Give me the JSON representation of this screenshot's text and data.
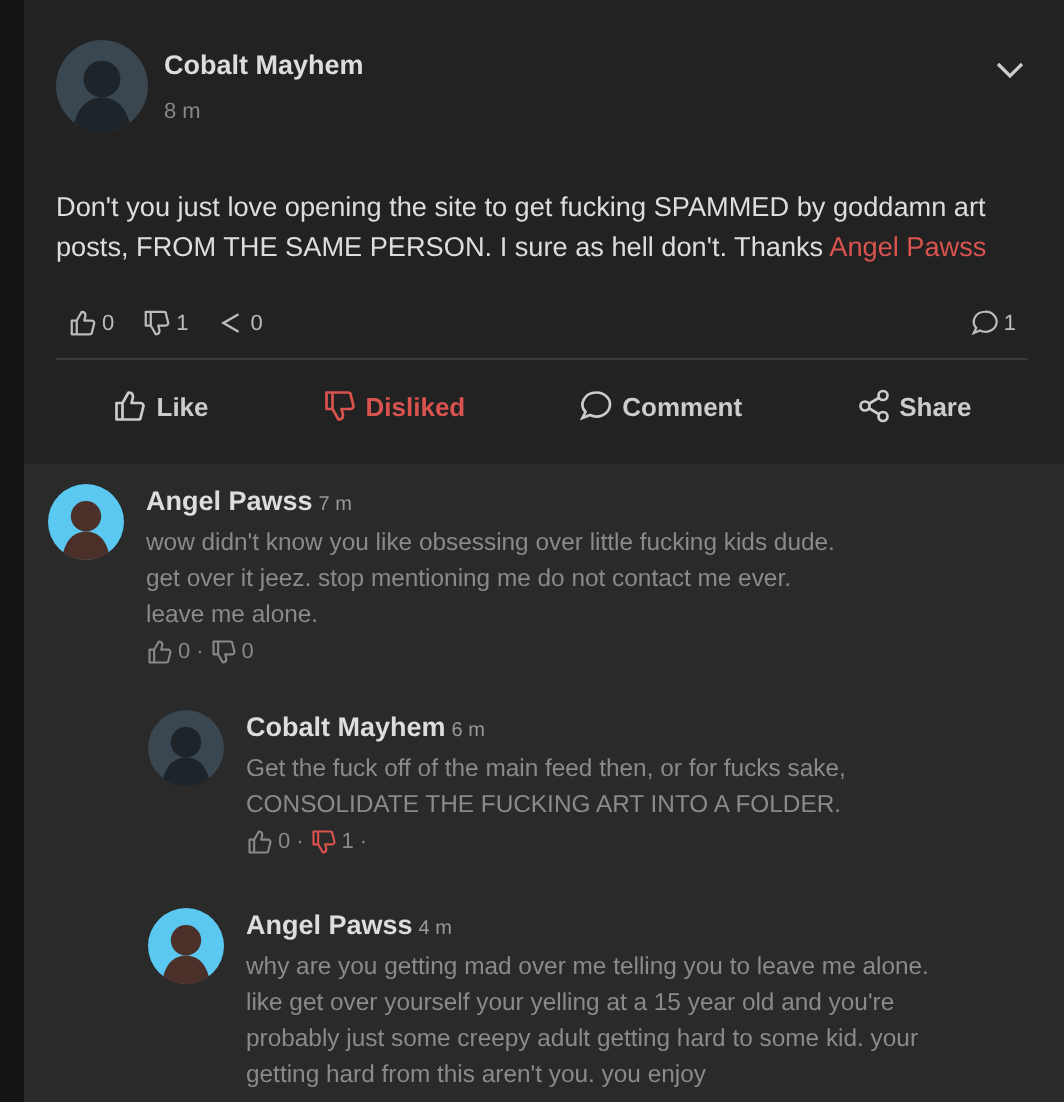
{
  "post": {
    "author": "Cobalt Mayhem",
    "time": "8 m",
    "text": "Don't you just love opening the site to get fucking SPAMMED by goddamn art posts, FROM THE SAME PERSON. I sure as hell don't. Thanks ",
    "mention": "Angel Pawss",
    "stats": [
      {
        "kind": "like",
        "count": "0"
      },
      {
        "kind": "dislike",
        "count": "1"
      },
      {
        "kind": "share",
        "count": "0"
      },
      {
        "kind": "comment",
        "count": "1"
      }
    ],
    "actions": [
      {
        "kind": "like",
        "label": "Like",
        "active": false
      },
      {
        "kind": "dislike",
        "label": "Disliked",
        "active": true
      },
      {
        "kind": "comment",
        "label": "Comment",
        "active": false
      },
      {
        "kind": "share",
        "label": "Share",
        "active": false
      }
    ]
  },
  "comments": [
    {
      "author": "Angel Pawss",
      "time": "7 m",
      "kind": "blue",
      "text": "wow didn't know you like obsessing over little fucking kids dude. get over it jeez. stop mentioning me do not contact me ever. leave me alone.",
      "votes": [
        {
          "kind": "like",
          "count": "0",
          "active": false,
          "sep": "·"
        },
        {
          "kind": "dislike",
          "count": "0",
          "active": false
        }
      ],
      "children": [
        {
          "author": "Cobalt Mayhem",
          "time": "6 m",
          "kind": "dark",
          "text": "Get the fuck off of the main feed then, or for fucks sake, CONSOLIDATE THE FUCKING ART INTO A FOLDER.",
          "votes": [
            {
              "kind": "like",
              "count": "0",
              "active": false,
              "sep": "·"
            },
            {
              "kind": "dislike",
              "count": "1",
              "active": true,
              "sep": "·"
            }
          ]
        },
        {
          "author": "Angel Pawss",
          "time": "4 m",
          "kind": "blue",
          "text": "why are you getting mad over me telling you to leave me alone. like get over yourself your yelling at a 15 year old and you're probably just some creepy adult getting hard to some kid. your getting hard from this aren't you. you enjoy"
        }
      ]
    }
  ]
}
